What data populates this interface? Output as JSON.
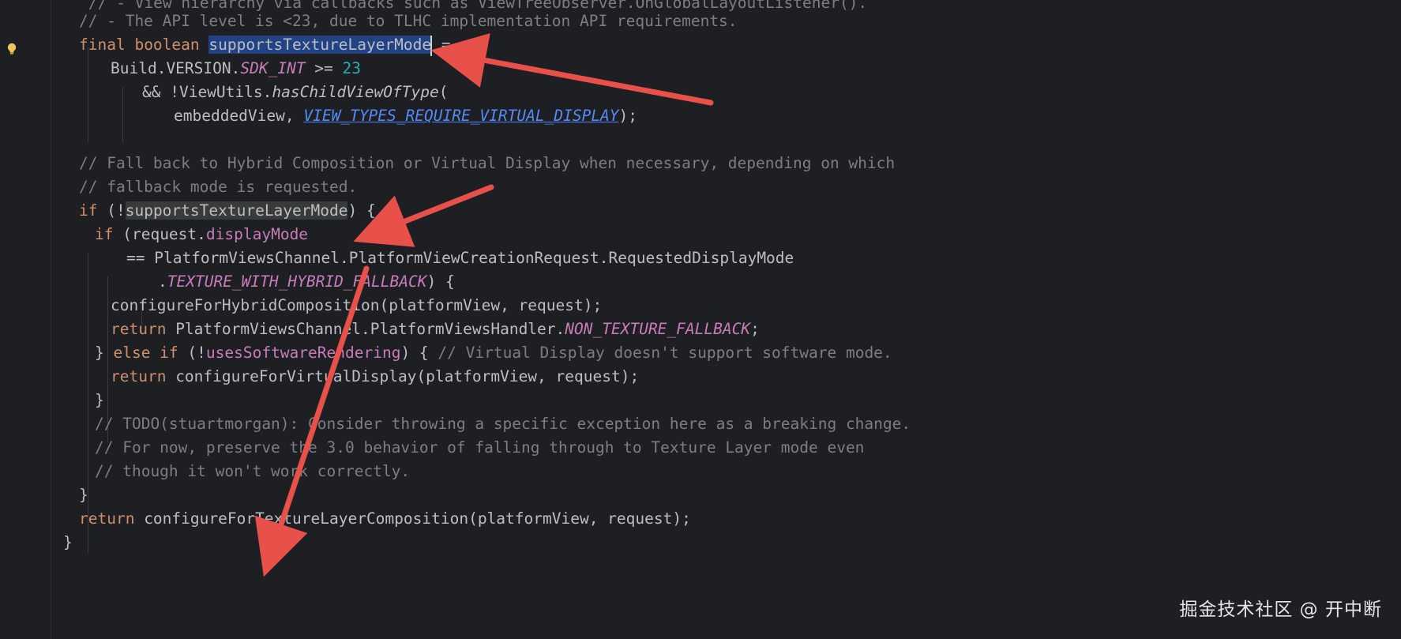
{
  "editor": {
    "lines": [
      {
        "id": "l0",
        "segments": [
          {
            "t": "// - View hierarchy via callbacks such as ViewTreeObserver.OnGlobalLayoutListener().",
            "c": "cmt"
          }
        ]
      },
      {
        "id": "l1",
        "segments": [
          {
            "t": "// - The API level is <23, due to TLHC implementation API requirements.",
            "c": "cmt"
          }
        ]
      },
      {
        "id": "l2",
        "segments": [
          {
            "t": "final ",
            "c": "kw"
          },
          {
            "t": "boolean ",
            "c": "kw"
          },
          {
            "t": "supportsTextureLayerMode",
            "c": "hl-sel"
          },
          {
            "t": "caret",
            "c": "caret"
          },
          {
            "t": " =",
            "c": ""
          }
        ]
      },
      {
        "id": "l3",
        "segments": [
          {
            "t": "Build.VERSION.",
            "c": ""
          },
          {
            "t": "SDK_INT",
            "c": "static-field"
          },
          {
            "t": " >= ",
            "c": ""
          },
          {
            "t": "23",
            "c": "num"
          }
        ]
      },
      {
        "id": "l4",
        "segments": [
          {
            "t": "&& !ViewUtils.",
            "c": ""
          },
          {
            "t": "hasChildViewOfType",
            "c": "method-static"
          },
          {
            "t": "(",
            "c": ""
          }
        ]
      },
      {
        "id": "l5",
        "segments": [
          {
            "t": "embeddedView, ",
            "c": ""
          },
          {
            "t": "VIEW_TYPES_REQUIRE_VIRTUAL_DISPLAY",
            "c": "link"
          },
          {
            "t": ");",
            "c": ""
          }
        ]
      },
      {
        "id": "l6",
        "segments": []
      },
      {
        "id": "l7",
        "segments": [
          {
            "t": "// Fall back to Hybrid Composition or Virtual Display when necessary, depending on which",
            "c": "cmt"
          }
        ]
      },
      {
        "id": "l8",
        "segments": [
          {
            "t": "// fallback mode is requested.",
            "c": "cmt"
          }
        ]
      },
      {
        "id": "l9",
        "segments": [
          {
            "t": "if ",
            "c": "kw"
          },
          {
            "t": "(!",
            "c": ""
          },
          {
            "t": "supportsTextureLayerMode",
            "c": "hl-use"
          },
          {
            "t": ") {",
            "c": ""
          }
        ]
      },
      {
        "id": "l10",
        "segments": [
          {
            "t": "if ",
            "c": "kw"
          },
          {
            "t": "(request.",
            "c": ""
          },
          {
            "t": "displayMode",
            "c": "field"
          }
        ]
      },
      {
        "id": "l11",
        "segments": [
          {
            "t": "== PlatformViewsChannel.PlatformViewCreationRequest.RequestedDisplayMode",
            "c": ""
          }
        ]
      },
      {
        "id": "l12",
        "segments": [
          {
            "t": ".",
            "c": ""
          },
          {
            "t": "TEXTURE_WITH_HYBRID_FALLBACK",
            "c": "static-const"
          },
          {
            "t": ") {",
            "c": ""
          }
        ]
      },
      {
        "id": "l13",
        "segments": [
          {
            "t": "configureForHybridComposition(platformView, request);",
            "c": ""
          }
        ]
      },
      {
        "id": "l14",
        "segments": [
          {
            "t": "return ",
            "c": "kw"
          },
          {
            "t": "PlatformViewsChannel.PlatformViewsHandler.",
            "c": ""
          },
          {
            "t": "NON_TEXTURE_FALLBACK",
            "c": "static-const"
          },
          {
            "t": ";",
            "c": ""
          }
        ]
      },
      {
        "id": "l15",
        "segments": [
          {
            "t": "} ",
            "c": ""
          },
          {
            "t": "else if ",
            "c": "kw"
          },
          {
            "t": "(!",
            "c": ""
          },
          {
            "t": "usesSoftwareRendering",
            "c": "field"
          },
          {
            "t": ") { ",
            "c": ""
          },
          {
            "t": "// Virtual Display doesn't support software mode.",
            "c": "cmt"
          }
        ]
      },
      {
        "id": "l16",
        "segments": [
          {
            "t": "return ",
            "c": "kw"
          },
          {
            "t": "configureForVirtualDisplay(platformView, request);",
            "c": ""
          }
        ]
      },
      {
        "id": "l17",
        "segments": [
          {
            "t": "}",
            "c": ""
          }
        ]
      },
      {
        "id": "l18",
        "segments": [
          {
            "t": "// TODO(stuartmorgan): Consider throwing a specific exception here as a breaking change.",
            "c": "cmt"
          }
        ]
      },
      {
        "id": "l19",
        "segments": [
          {
            "t": "// For now, preserve the 3.0 behavior of falling through to Texture Layer mode even",
            "c": "cmt"
          }
        ]
      },
      {
        "id": "l20",
        "segments": [
          {
            "t": "// though it won't work correctly.",
            "c": "cmt"
          }
        ]
      },
      {
        "id": "l21",
        "segments": [
          {
            "t": "}",
            "c": ""
          }
        ]
      },
      {
        "id": "l22",
        "segments": [
          {
            "t": "return ",
            "c": "kw"
          },
          {
            "t": "configureForTextureLayerComposition(platformView, request);",
            "c": ""
          }
        ]
      },
      {
        "id": "l23",
        "segments": [
          {
            "t": "}",
            "c": ""
          }
        ]
      }
    ]
  },
  "watermark": "掘金技术社区 @ 开中断",
  "colors": {
    "background": "#1e1f22",
    "keyword": "#cf8e6d",
    "comment": "#7a7e85",
    "number": "#2aacb8",
    "field": "#c77dbb",
    "link": "#548af7",
    "selection": "#214283",
    "usage_highlight": "#373b39",
    "arrow": "#e8504a"
  },
  "icons": {
    "gutter": "lightbulb-icon",
    "annotation": "red-arrow"
  }
}
